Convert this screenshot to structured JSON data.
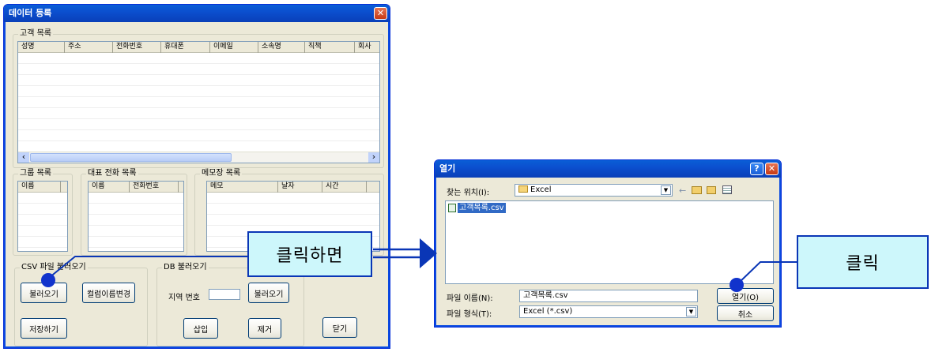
{
  "main_window": {
    "title": "데이터 등록",
    "customer_group": {
      "label": "고객 목록",
      "columns": [
        "성명",
        "주소",
        "전화번호",
        "휴대폰",
        "이메일",
        "소속명",
        "직책",
        "회사"
      ]
    },
    "group_list": {
      "label": "그룹 목록",
      "columns": [
        "이름"
      ]
    },
    "phone_list": {
      "label": "대표 전화 목록",
      "columns": [
        "이름",
        "전화번호"
      ]
    },
    "memo_list": {
      "label": "메모장 목록",
      "columns": [
        "메모",
        "날자",
        "시간"
      ]
    },
    "csv_group": {
      "label": "CSV 파일 불러오기",
      "load_button": "불러오기",
      "rename_button": "컬럼이름변경",
      "save_button": "저장하기"
    },
    "db_group": {
      "label": "DB 불러오기",
      "region_label": "지역 번호",
      "region_value": "",
      "load_button": "불러오기",
      "insert_button": "삽입",
      "remove_button": "제거"
    },
    "close_button": "닫기"
  },
  "open_dialog": {
    "title": "열기",
    "look_in_label": "찾는 위치(I):",
    "look_in_value": "Excel",
    "files": [
      {
        "name": "고객목록.csv",
        "selected": true
      }
    ],
    "filename_label": "파일 이름(N):",
    "filename_value": "고객목록.csv",
    "filetype_label": "파일 형식(T):",
    "filetype_value": "Excel (*.csv)",
    "open_button": "열기(O)",
    "cancel_button": "취소",
    "help_glyph": "?",
    "close_glyph": "✕"
  },
  "annotations": {
    "callout_main": "클릭하면",
    "callout_dialog": "클릭",
    "callout_color": "#cdf7fb",
    "line_color": "#0a36b6"
  },
  "icons": {
    "close": "✕",
    "scroll_left": "‹",
    "scroll_right": "›",
    "dropdown": "▼"
  }
}
